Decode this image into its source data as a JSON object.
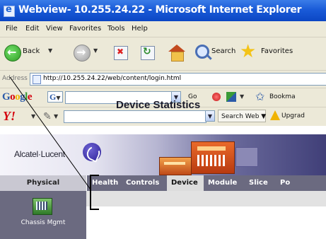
{
  "window": {
    "title": "Webview- 10.255.24.22 - Microsoft Internet Explorer"
  },
  "menu": {
    "items": [
      "File",
      "Edit",
      "View",
      "Favorites",
      "Tools",
      "Help"
    ]
  },
  "toolbar": {
    "back_label": "Back",
    "search_label": "Search",
    "favorites_label": "Favorites",
    "icons": [
      "back-icon",
      "forward-icon",
      "stop-icon",
      "refresh-icon",
      "home-icon",
      "search-icon",
      "favorites-star-icon"
    ]
  },
  "address": {
    "label": "Address",
    "url": "http://10.255.24.22/web/content/login.html"
  },
  "google_bar": {
    "logo": "Google",
    "g_button": "G",
    "go_label": "Go",
    "bookmarks_label": "Bookma"
  },
  "yahoo_bar": {
    "logo": "Y!",
    "search_web_label": "Search Web",
    "upgrade_label": "Upgrad"
  },
  "page": {
    "brand": "Alcatel·Lucent",
    "tabs": {
      "physical": "Physical",
      "items": [
        "Health",
        "Controls",
        "Device",
        "Module",
        "Slice",
        "Po"
      ],
      "active": "Device"
    },
    "left_nav": {
      "chassis_label": "Chassis Mgmt"
    },
    "heading": "Device Statistics"
  },
  "colors": {
    "titlebar": "#0b46c4",
    "chrome": "#ece9d8",
    "nav": "#6b6a80",
    "active_tab": "#dcdcdc"
  }
}
